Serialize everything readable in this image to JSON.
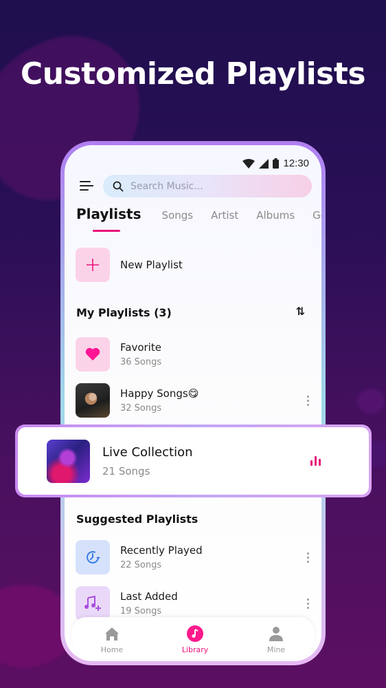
{
  "headline": "Customized Playlists",
  "status_bar": {
    "time": "12:30",
    "icons": [
      "wifi-icon",
      "signal-icon",
      "battery-icon"
    ]
  },
  "search": {
    "placeholder": "Search Music..."
  },
  "tabs": [
    {
      "label": "Playlists",
      "active": true
    },
    {
      "label": "Songs",
      "active": false
    },
    {
      "label": "Artist",
      "active": false
    },
    {
      "label": "Albums",
      "active": false
    },
    {
      "label": "Ge",
      "active": false
    }
  ],
  "new_playlist": {
    "label": "New Playlist",
    "icon": "plus-icon"
  },
  "my_playlists": {
    "title": "My Playlists (3)",
    "sort_icon": "sort-icon",
    "items": [
      {
        "title": "Favorite",
        "subtitle": "36 Songs",
        "icon": "heart-icon"
      },
      {
        "title": "Happy Songs😋",
        "subtitle": "32 Songs",
        "icon": "photo-thumbnail"
      }
    ]
  },
  "now_playing": {
    "title": "Live Collection",
    "subtitle": "21 Songs",
    "icon": "equalizer-icon"
  },
  "suggested": {
    "title": "Suggested Playlists",
    "items": [
      {
        "title": "Recently Played",
        "subtitle": "22 Songs",
        "icon": "history-icon"
      },
      {
        "title": "Last Added",
        "subtitle": "19 Songs",
        "icon": "music-add-icon"
      }
    ]
  },
  "bottom_nav": [
    {
      "label": "Home",
      "icon": "home-icon",
      "active": false
    },
    {
      "label": "Library",
      "icon": "music-note-icon",
      "active": true
    },
    {
      "label": "Mine",
      "icon": "person-icon",
      "active": false
    }
  ],
  "colors": {
    "accent": "#e8117a",
    "background_top": "#1f0f4e",
    "background_bottom": "#5c0f62"
  }
}
